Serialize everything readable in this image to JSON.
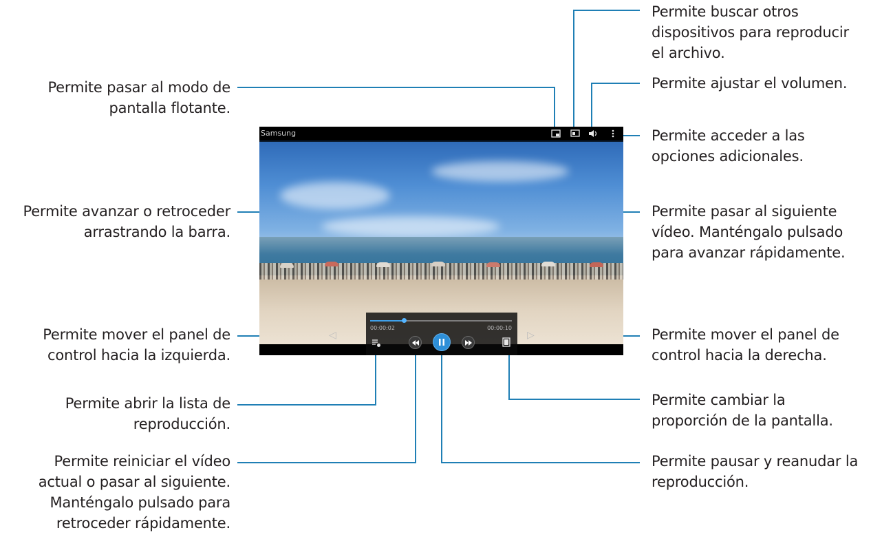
{
  "annotations": {
    "floating_mode": [
      "Permite pasar al modo de",
      "pantalla flotante."
    ],
    "seek_bar": [
      "Permite avanzar o retroceder",
      "arrastrando la barra."
    ],
    "panel_left": [
      "Permite mover el panel de",
      "control hacia la izquierda."
    ],
    "playlist": [
      "Permite abrir la lista de",
      "reproducción."
    ],
    "previous": [
      "Permite reiniciar el vídeo",
      "actual o pasar al siguiente.",
      "Manténgalo pulsado para",
      "retroceder rápidamente."
    ],
    "devices": [
      "Permite buscar otros",
      "dispositivos para reproducir",
      "el archivo."
    ],
    "volume": [
      "Permite ajustar el volumen."
    ],
    "more_options": [
      "Permite acceder a las",
      "opciones adicionales."
    ],
    "next": [
      "Permite pasar al siguiente",
      "vídeo. Manténgalo pulsado",
      "para avanzar rápidamente."
    ],
    "panel_right": [
      "Permite mover el panel de",
      "control hacia la derecha."
    ],
    "aspect_ratio": [
      "Permite cambiar la",
      "proporción de la pantalla."
    ],
    "play_pause": [
      "Permite pausar y reanudar la",
      "reproducción."
    ]
  },
  "screen": {
    "title": "Samsung",
    "current_time": "00:00:02",
    "total_time": "00:00:10",
    "progress": 0.24,
    "icons": {
      "floating": "pip-icon",
      "cast": "screen-mirror-icon",
      "volume": "speaker-icon",
      "menu": "more-vertical-icon",
      "playlist": "playlist-icon",
      "previous": "rewind-icon",
      "pause": "pause-icon",
      "next": "fast-forward-icon",
      "ratio": "aspect-ratio-icon",
      "left": "triangle-left-icon",
      "right": "triangle-right-icon"
    }
  },
  "colors": {
    "callout_line": "#1f7fb5",
    "accent_play": "#2e8fd8",
    "text": "#231f20"
  }
}
